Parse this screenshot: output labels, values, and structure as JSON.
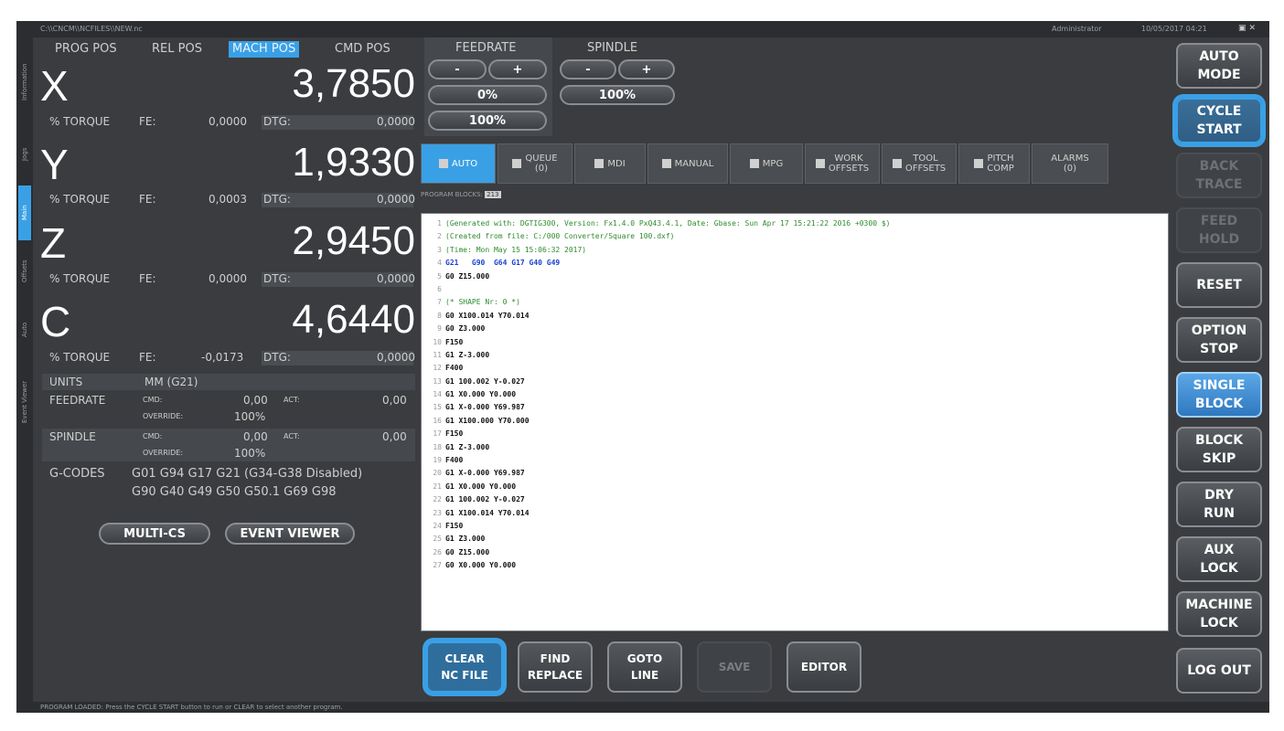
{
  "titlebar": {
    "path": "C:\\\\CNCM\\\\NCFILES\\\\NEW.nc",
    "user": "Administrator",
    "time": "10/05/2017 04:21",
    "icons": [
      "window-icon",
      "close-icon"
    ]
  },
  "side_tabs": [
    "Information",
    "Jogs",
    "Main",
    "Offsets",
    "Auto",
    "Event Viewer"
  ],
  "position_tabs": [
    "PROG POS",
    "REL POS",
    "MACH POS",
    "CMD POS"
  ],
  "axes": [
    {
      "letter": "X",
      "value": "3,7850",
      "torque_label": "% TORQUE",
      "fe_label": "FE:",
      "fe": "0,0000",
      "dtg_label": "DTG:",
      "dtg": "0,0000"
    },
    {
      "letter": "Y",
      "value": "1,9330",
      "torque_label": "% TORQUE",
      "fe_label": "FE:",
      "fe": "0,0003",
      "dtg_label": "DTG:",
      "dtg": "0,0000"
    },
    {
      "letter": "Z",
      "value": "2,9450",
      "torque_label": "% TORQUE",
      "fe_label": "FE:",
      "fe": "0,0000",
      "dtg_label": "DTG:",
      "dtg": "0,0000"
    },
    {
      "letter": "C",
      "value": "4,6440",
      "torque_label": "% TORQUE",
      "fe_label": "FE:",
      "fe": "-0,0173",
      "dtg_label": "DTG:",
      "dtg": "0,0000"
    }
  ],
  "units": {
    "label": "UNITS",
    "value": "MM (G21)"
  },
  "feedrate": {
    "label": "FEEDRATE",
    "cmd_label": "CMD:",
    "cmd": "0,00",
    "act_label": "ACT:",
    "act": "0,00",
    "override_label": "OVERRIDE:",
    "override": "100%"
  },
  "spindle_info": {
    "label": "SPINDLE",
    "cmd_label": "CMD:",
    "cmd": "0,00",
    "act_label": "ACT:",
    "act": "0,00",
    "override_label": "OVERRIDE:",
    "override": "100%"
  },
  "gcodes": {
    "label": "G-CODES",
    "line1": "G01 G94 G17 G21 (G34-G38 Disabled)",
    "line2": "G90 G40 G49 G50 G50.1 G69 G98"
  },
  "left_buttons": {
    "multi_cs": "MULTI-CS",
    "event_viewer": "EVENT VIEWER"
  },
  "feed_ctrl": {
    "label": "FEEDRATE",
    "minus": "-",
    "plus": "+",
    "pct1": "0%",
    "pct2": "100%"
  },
  "spindle_ctrl": {
    "label": "SPINDLE",
    "minus": "-",
    "plus": "+",
    "pct": "100%"
  },
  "tabs": [
    {
      "line1": "AUTO",
      "line2": ""
    },
    {
      "line1": "QUEUE",
      "line2": "(0)"
    },
    {
      "line1": "MDI",
      "line2": ""
    },
    {
      "line1": "MANUAL",
      "line2": ""
    },
    {
      "line1": "MPG",
      "line2": ""
    },
    {
      "line1": "WORK",
      "line2": "OFFSETS"
    },
    {
      "line1": "TOOL",
      "line2": "OFFSETS"
    },
    {
      "line1": "PITCH",
      "line2": "COMP"
    },
    {
      "line1": "ALARMS",
      "line2": "(0)"
    }
  ],
  "program_label": "PROGRAM BLOCKS:",
  "program_count": "213",
  "program": [
    {
      "t": "(Generated with: DGTIG300, Version: Fx1.4.0 PxQ43.4.1, Date: Gbase: Sun Apr 17 15:21:22 2016 +0300 $)",
      "c": "comment"
    },
    {
      "t": "(Created from file: C:/000 Converter/Square 100.dxf)",
      "c": "comment"
    },
    {
      "t": "(Time: Mon May 15 15:06:32 2017)",
      "c": "comment"
    },
    {
      "t": "G21   G90  G64 G17 G40 G49",
      "c": "blue"
    },
    {
      "t": "G0 Z15.000",
      "c": "black"
    },
    {
      "t": "",
      "c": "black"
    },
    {
      "t": "(* SHAPE Nr: 0 *)",
      "c": "comment"
    },
    {
      "t": "G0 X100.014 Y70.014",
      "c": "black"
    },
    {
      "t": "G0 Z3.000",
      "c": "black"
    },
    {
      "t": "F150",
      "c": "black"
    },
    {
      "t": "G1 Z-3.000",
      "c": "black"
    },
    {
      "t": "F400",
      "c": "black"
    },
    {
      "t": "G1 100.002 Y-0.027",
      "c": "black"
    },
    {
      "t": "G1 X0.000 Y0.000",
      "c": "black"
    },
    {
      "t": "G1 X-0.000 Y69.987",
      "c": "black"
    },
    {
      "t": "G1 X100.000 Y70.000",
      "c": "black"
    },
    {
      "t": "F150",
      "c": "black"
    },
    {
      "t": "G1 Z-3.000",
      "c": "black"
    },
    {
      "t": "F400",
      "c": "black"
    },
    {
      "t": "G1 X-0.000 Y69.987",
      "c": "black"
    },
    {
      "t": "G1 X0.000 Y0.000",
      "c": "black"
    },
    {
      "t": "G1 100.002 Y-0.027",
      "c": "black"
    },
    {
      "t": "G1 X100.014 Y70.014",
      "c": "black"
    },
    {
      "t": "F150",
      "c": "black"
    },
    {
      "t": "G1 Z3.000",
      "c": "black"
    },
    {
      "t": "G0 Z15.000",
      "c": "black"
    },
    {
      "t": "G0 X0.000 Y0.000",
      "c": "black"
    }
  ],
  "bottom_buttons": [
    {
      "l1": "CLEAR",
      "l2": "NC FILE"
    },
    {
      "l1": "FIND",
      "l2": "REPLACE"
    },
    {
      "l1": "GOTO",
      "l2": "LINE"
    },
    {
      "l1": "SAVE",
      "l2": ""
    },
    {
      "l1": "EDITOR",
      "l2": ""
    }
  ],
  "right_buttons": [
    {
      "l1": "AUTO",
      "l2": "MODE"
    },
    {
      "l1": "CYCLE",
      "l2": "START"
    },
    {
      "l1": "BACK",
      "l2": "TRACE"
    },
    {
      "l1": "FEED",
      "l2": "HOLD"
    },
    {
      "l1": "RESET",
      "l2": ""
    },
    {
      "l1": "OPTION",
      "l2": "STOP"
    },
    {
      "l1": "SINGLE",
      "l2": "BLOCK"
    },
    {
      "l1": "BLOCK",
      "l2": "SKIP"
    },
    {
      "l1": "DRY",
      "l2": "RUN"
    },
    {
      "l1": "AUX",
      "l2": "LOCK"
    },
    {
      "l1": "MACHINE",
      "l2": "LOCK"
    },
    {
      "l1": "LOG OUT",
      "l2": ""
    }
  ],
  "status": "PROGRAM LOADED: Press the CYCLE START button to run or CLEAR to select another program.",
  "colors": {
    "accent": "#3aa0e6",
    "background": "#3a3c3f",
    "panel": "#45484c"
  }
}
